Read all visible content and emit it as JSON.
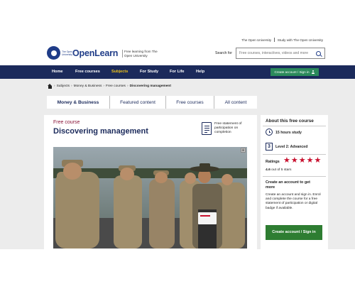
{
  "toplinks": {
    "link1": "The Open University",
    "link2": "Study with The Open University"
  },
  "logo": {
    "ou_text": "The Open University",
    "name": "OpenLearn",
    "tagline": "Free learning from The Open University"
  },
  "search": {
    "label": "Search for",
    "placeholder": "Free courses, interactives, videos and more",
    "icon": "search-icon"
  },
  "nav": {
    "items": [
      "Home",
      "Free courses",
      "Subjects",
      "For Study",
      "For Life",
      "Help"
    ],
    "active_index": 2,
    "signin_label": "Create account / Sign in",
    "bg_color": "#1b2a5b",
    "active_color": "#f0c419"
  },
  "breadcrumb": {
    "items": [
      "Subjects",
      "Money & Business",
      "Free courses"
    ],
    "current": "Discovering management"
  },
  "tabs": [
    "Money & Business",
    "Featured content",
    "Free courses",
    "All content"
  ],
  "course": {
    "label": "Free course",
    "title": "Discovering management",
    "cert_text": "Free statement of participation on completion",
    "image_close": "⊠"
  },
  "sidebar": {
    "heading": "About this free course",
    "hours": "15 hours study",
    "level_number": "3",
    "level_text": "Level 2: Advanced",
    "ratings_label": "Ratings",
    "rating_value": 4.6,
    "rating_text_strong": "4.6",
    "rating_text_rest": " out of 5 stars",
    "create_heading": "Create an account to get more",
    "create_body": "Create an account and sign in. Enrol and complete the course for a free statement of participation or digital badge if available.",
    "create_button": "Create account / Sign in",
    "accent_color": "#c8102e",
    "button_color": "#2e7d32"
  }
}
